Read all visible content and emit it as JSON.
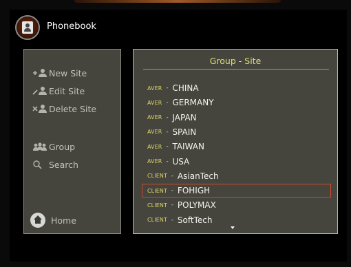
{
  "header": {
    "title": "Phonebook",
    "icon": "phonebook-contact-icon"
  },
  "menu": {
    "items": [
      {
        "label": "New Site",
        "icon": "add-person-icon"
      },
      {
        "label": "Edit Site",
        "icon": "edit-person-icon"
      },
      {
        "label": "Delete Site",
        "icon": "delete-person-icon"
      },
      {
        "label": "Group",
        "icon": "group-icon"
      },
      {
        "label": "Search",
        "icon": "search-icon"
      }
    ],
    "home": {
      "label": "Home",
      "icon": "home-icon"
    }
  },
  "list_panel": {
    "title_group": "Group",
    "title_separator": " - ",
    "title_site": "Site",
    "rows": [
      {
        "group": "AVER",
        "site": "CHINA"
      },
      {
        "group": "AVER",
        "site": "GERMANY"
      },
      {
        "group": "AVER",
        "site": "JAPAN"
      },
      {
        "group": "AVER",
        "site": "SPAIN"
      },
      {
        "group": "AVER",
        "site": "TAIWAN"
      },
      {
        "group": "AVER",
        "site": "USA"
      },
      {
        "group": "CLIENT",
        "site": "AsianTech"
      },
      {
        "group": "CLIENT",
        "site": "FOHIGH",
        "selected": true
      },
      {
        "group": "CLIENT",
        "site": "POLYMAX"
      },
      {
        "group": "CLIENT",
        "site": "SoftTech"
      }
    ],
    "separator": " - ",
    "scroll_indicator": "down-arrow-icon"
  },
  "colors": {
    "panel_bg": "#45453e",
    "group_prefix": "#dcd468",
    "selection_border": "#d24a2a"
  }
}
